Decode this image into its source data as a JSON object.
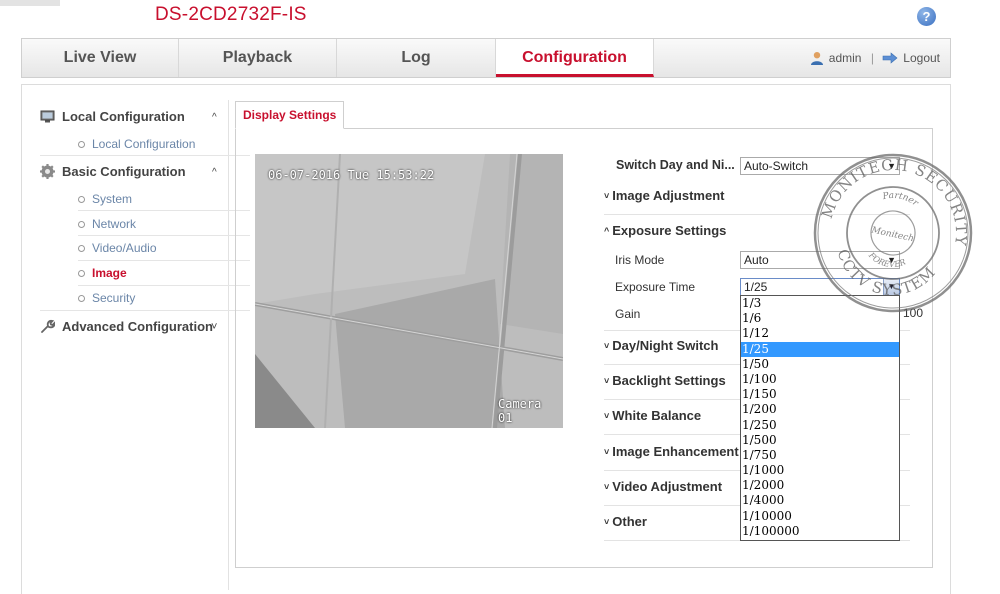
{
  "header": {
    "model": "DS-2CD2732F-IS",
    "help_glyph": "?"
  },
  "nav": {
    "tabs": [
      {
        "label": "Live View",
        "active": false
      },
      {
        "label": "Playback",
        "active": false
      },
      {
        "label": "Log",
        "active": false
      },
      {
        "label": "Configuration",
        "active": true
      }
    ],
    "user": "admin",
    "separator": "|",
    "logout": "Logout"
  },
  "sidebar": {
    "local": {
      "label": "Local Configuration",
      "caret": "^",
      "items": [
        "Local Configuration"
      ]
    },
    "basic": {
      "label": "Basic Configuration",
      "caret": "^",
      "items": [
        "System",
        "Network",
        "Video/Audio",
        "Image",
        "Security"
      ],
      "active_item": "Image"
    },
    "advanced": {
      "label": "Advanced Configuration",
      "caret": "˅"
    }
  },
  "content": {
    "tab": "Display Settings",
    "preview": {
      "timestamp": "06-07-2016 Tue 15:53:22",
      "camera_name": "Camera 01"
    },
    "switch_day_night": {
      "label": "Switch Day and Ni...",
      "value": "Auto-Switch"
    },
    "sections": {
      "image_adjustment": "Image Adjustment",
      "exposure_settings": "Exposure Settings",
      "day_night_switch": "Day/Night Switch",
      "backlight_settings": "Backlight Settings",
      "white_balance": "White Balance",
      "image_enhancement": "Image Enhancement",
      "video_adjustment": "Video Adjustment",
      "other": "Other"
    },
    "collapsed_chevron": "˅",
    "expanded_chevron": "^",
    "iris_mode": {
      "label": "Iris Mode",
      "value": "Auto"
    },
    "exposure_time": {
      "label": "Exposure Time",
      "value": "1/25",
      "options": [
        "1/3",
        "1/6",
        "1/12",
        "1/25",
        "1/50",
        "1/100",
        "1/150",
        "1/200",
        "1/250",
        "1/500",
        "1/750",
        "1/1000",
        "1/2000",
        "1/4000",
        "1/10000",
        "1/100000"
      ],
      "selected_index": 3
    },
    "gain": {
      "label": "Gain",
      "value": "100"
    }
  },
  "watermark": {
    "outer_text": "MONITECH SECURITY",
    "bottom_text": "CCTV SYSTEM",
    "inner_top": "Partner",
    "center": "Monitech",
    "inner_bottom": "FOREVER"
  },
  "colors": {
    "accent": "#c8102e",
    "link": "#6b86a8",
    "selection": "#3399ff"
  },
  "icons": {
    "help": "help-icon",
    "user": "user-icon",
    "logout": "logout-icon",
    "local": "monitor-icon",
    "basic": "gear-icon",
    "advanced": "wrench-icon"
  }
}
